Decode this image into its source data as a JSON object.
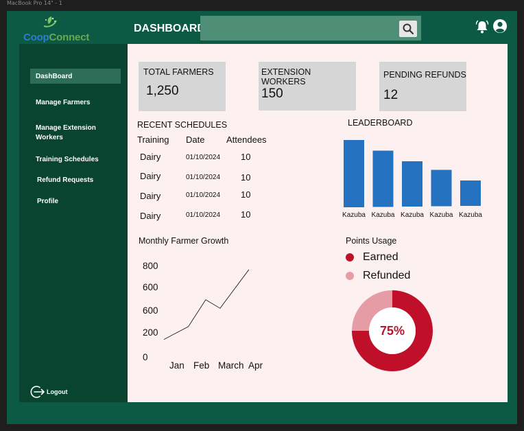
{
  "frame": {
    "label": "MacBook Pro 14\" - 1"
  },
  "app": {
    "logo_part1": "Coop",
    "logo_part2": "Connect",
    "header_title": "DASHBOARD"
  },
  "sidebar": {
    "items": [
      {
        "label": "DashBoard",
        "active": true
      },
      {
        "label": "Manage Farmers",
        "active": false
      },
      {
        "label": "Manage Extension Workers",
        "active": false
      },
      {
        "label": "Training Schedules",
        "active": false
      },
      {
        "label": "Refund Requests",
        "active": false
      },
      {
        "label": "Profile",
        "active": false
      }
    ],
    "logout_label": "Logout"
  },
  "cards": [
    {
      "label": "TOTAL FARMERS",
      "value": "1,250"
    },
    {
      "label": "EXTENSION WORKERS",
      "value": "150"
    },
    {
      "label": "PENDING REFUNDS",
      "value": "12"
    }
  ],
  "schedules": {
    "title": "RECENT SCHEDULES",
    "columns": [
      "Training",
      "Date",
      "Attendees"
    ],
    "rows": [
      {
        "training": "Dairy",
        "date": "01/10/2024",
        "attendees": "10"
      },
      {
        "training": "Dairy",
        "date": "01/10/2024",
        "attendees": "10"
      },
      {
        "training": "Dairy",
        "date": "01/10/2024",
        "attendees": "10"
      },
      {
        "training": "Dairy",
        "date": "01/10/2024",
        "attendees": "10"
      }
    ]
  },
  "colors": {
    "sidebar": "#08442f",
    "app_bg": "#0c5a44",
    "main_bg": "#fdf0f0",
    "bar": "#2472c0",
    "earned": "#c00f28",
    "refunded": "#e59ca4"
  },
  "icons": {
    "search": "search-icon",
    "bell": "bell-icon",
    "user": "user-icon",
    "logout": "logout-icon",
    "logo": "leaf-logo-icon"
  },
  "chart_data": [
    {
      "type": "bar",
      "title": "LEADERBOARD",
      "categories": [
        "Kazuba",
        "Kazuba",
        "Kazuba",
        "Kazuba",
        "Kazuba"
      ],
      "values": [
        98,
        82,
        66,
        53,
        37
      ]
    },
    {
      "type": "line",
      "title": "Monthly Farmer Growth",
      "y_tick_labels": [
        "800",
        "600",
        "600",
        "200",
        "0"
      ],
      "x_tick_labels": [
        "Jan",
        "Feb",
        "March",
        "Apr"
      ],
      "points": [
        {
          "x": 0.0,
          "y": 130
        },
        {
          "x": 0.85,
          "y": 250
        },
        {
          "x": 1.45,
          "y": 500
        },
        {
          "x": 1.95,
          "y": 420
        },
        {
          "x": 2.95,
          "y": 780
        }
      ],
      "ylim": [
        0,
        900
      ],
      "xlim": [
        0,
        3
      ]
    },
    {
      "type": "pie",
      "title": "Points Usage",
      "series": [
        {
          "name": "Earned",
          "value": 75
        },
        {
          "name": "Refunded",
          "value": 25
        }
      ],
      "center_label": "75%"
    }
  ]
}
